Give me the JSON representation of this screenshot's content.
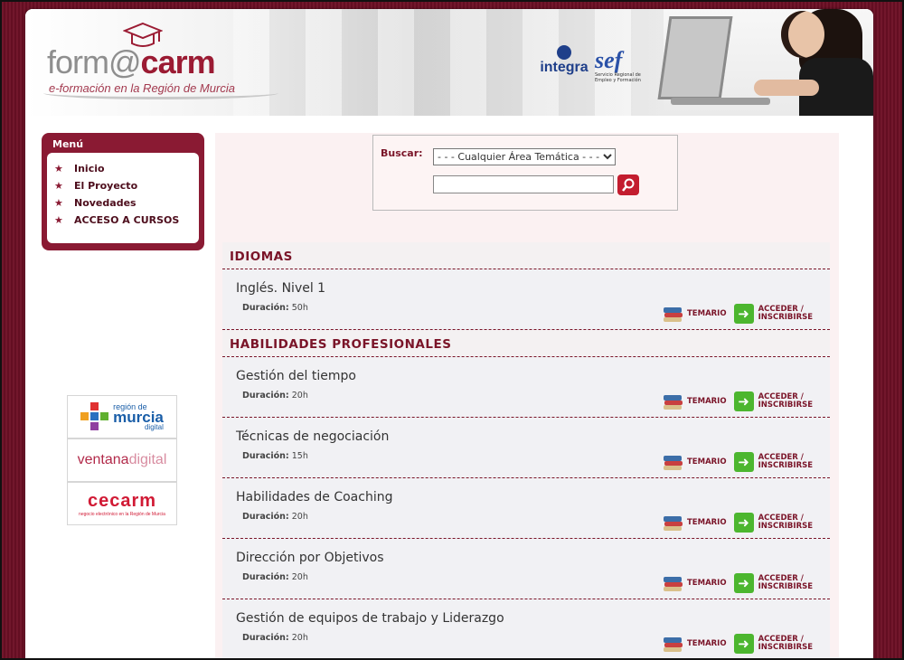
{
  "header": {
    "logo_part1": "form@",
    "logo_part2": "carm",
    "tagline": "e-formación en la Región de Murcia",
    "integra_label": "integra",
    "sef_label": "sef",
    "sef_sub": "Servicio Regional de Empleo y Formación"
  },
  "menu": {
    "title": "Menú",
    "items": [
      {
        "label": "Inicio"
      },
      {
        "label": "El Proyecto"
      },
      {
        "label": "Novedades"
      },
      {
        "label": "ACCESO A CURSOS"
      }
    ]
  },
  "partners": {
    "murcia_a": "región de",
    "murcia_b": "murcia",
    "murcia_c": "digital",
    "ventana_a": "ventana",
    "ventana_b": "digital",
    "cecarm_a": "cecarm",
    "cecarm_b": "negocio electrónico en la Región de Murcia"
  },
  "search": {
    "label": "Buscar:",
    "select_value": "- - - Cualquier Área Temática - - -",
    "input_value": "",
    "button_icon": "search-icon"
  },
  "actions": {
    "temario": "TEMARIO",
    "acceder_1": "ACCEDER /",
    "acceder_2": "INSCRIBIRSE"
  },
  "categories": [
    {
      "title": "IDIOMAS",
      "courses": [
        {
          "name": "Inglés. Nivel 1",
          "duration_label": "Duración:",
          "duration": "50h"
        }
      ]
    },
    {
      "title": "HABILIDADES PROFESIONALES",
      "courses": [
        {
          "name": "Gestión del tiempo",
          "duration_label": "Duración:",
          "duration": "20h"
        },
        {
          "name": "Técnicas de negociación",
          "duration_label": "Duración:",
          "duration": "15h"
        },
        {
          "name": "Habilidades de Coaching",
          "duration_label": "Duración:",
          "duration": "20h"
        },
        {
          "name": "Dirección por Objetivos",
          "duration_label": "Duración:",
          "duration": "20h"
        },
        {
          "name": "Gestión de equipos de trabajo y Liderazgo",
          "duration_label": "Duración:",
          "duration": "20h"
        }
      ]
    }
  ]
}
